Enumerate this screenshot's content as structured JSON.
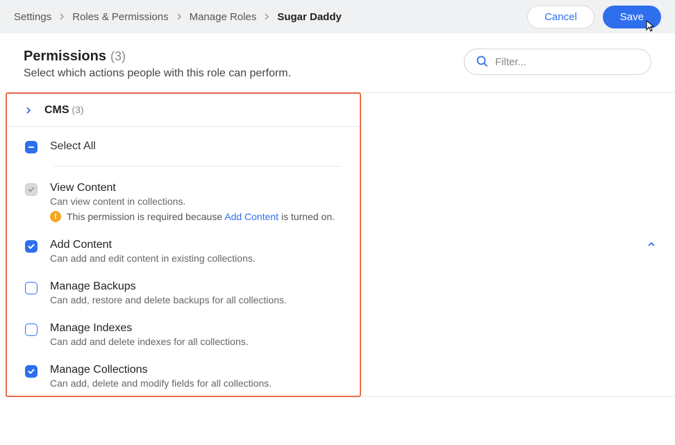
{
  "breadcrumbs": [
    {
      "label": "Settings"
    },
    {
      "label": "Roles & Permissions"
    },
    {
      "label": "Manage Roles"
    },
    {
      "label": "Sugar Daddy"
    }
  ],
  "actions": {
    "cancel": "Cancel",
    "save": "Save"
  },
  "title": {
    "heading": "Permissions",
    "count": "(3)",
    "subtitle": "Select which actions people with this role can perform."
  },
  "filter": {
    "placeholder": "Filter..."
  },
  "section": {
    "name": "CMS",
    "count": "(3)",
    "select_all": "Select All"
  },
  "permissions": [
    {
      "key": "view-content",
      "title": "View Content",
      "desc": "Can view content in collections.",
      "state": "checked_disabled",
      "note_prefix": "This permission is required because ",
      "note_link": "Add Content",
      "note_suffix": " is turned on."
    },
    {
      "key": "add-content",
      "title": "Add Content",
      "desc": "Can add and edit content in existing collections.",
      "state": "checked"
    },
    {
      "key": "manage-backups",
      "title": "Manage Backups",
      "desc": "Can add, restore and delete backups for all collections.",
      "state": "unchecked"
    },
    {
      "key": "manage-indexes",
      "title": "Manage Indexes",
      "desc": "Can add and delete indexes for all collections.",
      "state": "unchecked"
    },
    {
      "key": "manage-collections",
      "title": "Manage Collections",
      "desc": "Can add, delete and modify fields for all collections.",
      "state": "checked"
    }
  ]
}
